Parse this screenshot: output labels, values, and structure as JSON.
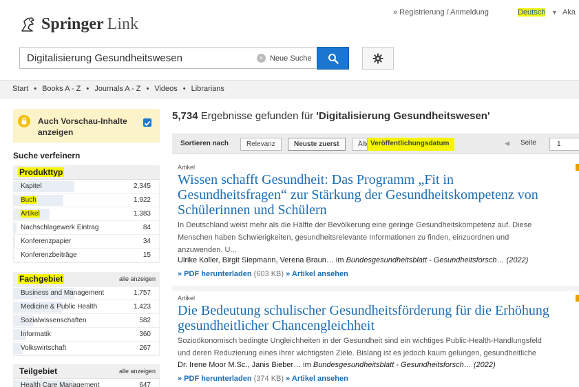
{
  "header": {
    "brand": "Springer",
    "brand_suffix": "Link",
    "register_link": "» Registrierung / Anmeldung",
    "language": "Deutsch",
    "language_caret": "▼",
    "extra": "Aka"
  },
  "search": {
    "value": "Digitalisierung Gesundheitswesen",
    "clear_icon": "×",
    "clear_label": "Neue Suche"
  },
  "nav": {
    "items": [
      "Start",
      "Books A - Z",
      "Journals A - Z",
      "Videos",
      "Librarians"
    ],
    "separator": "•"
  },
  "sidebar": {
    "preview_label": "Auch Vorschau-Inhalte anzeigen",
    "refine_title": "Suche verfeinern",
    "facets": [
      {
        "title": "Produkttyp",
        "all_label": "",
        "items": [
          {
            "label": "Kapitel",
            "count": "2,345",
            "share": 1.0
          },
          {
            "label": "Buch",
            "count": "1,922",
            "share": 0.82
          },
          {
            "label": "Artikel",
            "count": "1,383",
            "share": 0.59
          },
          {
            "label": "Nachschlagewerk Eintrag",
            "count": "84",
            "share": 0.04
          },
          {
            "label": "Konferenzpapier",
            "count": "34",
            "share": 0.02
          },
          {
            "label": "Konferenzbeiträge",
            "count": "15",
            "share": 0.01
          }
        ]
      },
      {
        "title": "Fachgebiet",
        "all_label": "alle anzeigen",
        "items": [
          {
            "label": "Business and Management",
            "count": "1,757",
            "share": 1.0
          },
          {
            "label": "Medicine & Public Health",
            "count": "1,423",
            "share": 0.81
          },
          {
            "label": "Sozialwissenschaften",
            "count": "582",
            "share": 0.33
          },
          {
            "label": "Informatik",
            "count": "360",
            "share": 0.2
          },
          {
            "label": "Volkswirtschaft",
            "count": "267",
            "share": 0.15
          }
        ]
      },
      {
        "title": "Teilgebiet",
        "all_label": "alle anzeigen",
        "items": [
          {
            "label": "Health Care Management",
            "count": "647",
            "share": 1.0
          }
        ]
      }
    ]
  },
  "results": {
    "count": "5,734",
    "count_text": " Ergebnisse gefunden für ",
    "query": "'Digitalisierung Gesundheitswesen'",
    "sort": {
      "label": "Sortieren nach",
      "relevance": "Relevanz",
      "newest": "Neuste zuerst",
      "oldest": "Älteste zuerst",
      "date": "Veröffentlichungsdatum"
    },
    "pagination": {
      "prev": "◀",
      "page_label": "Seite",
      "page_value": "1"
    },
    "items": [
      {
        "type": "Artikel",
        "title_lines": [
          "Wissen schafft Gesundheit: Das Programm „Fit in",
          "Gesundheitsfragen“ zur Stärkung der Gesundheitskompetenz von",
          "Schülerinnen und Schülern"
        ],
        "snippet_lines": [
          "In Deutschland weist mehr als die Hälfte der Bevölkerung eine geringe Gesundheitskompetenz auf. Diese",
          "Menschen haben Schwierigkeiten, gesundheitsrelevante Informationen zu finden, einzuordnen und",
          "anzuwenden. U..."
        ],
        "authors": "Ulrike Koller, Birgit Siepmann, Verena Braun…",
        "in": " im ",
        "journal": "Bundesgesundheitsblatt - Gesundheitsforsch… (2022)",
        "pdf_link": "» PDF herunterladen",
        "pdf_size": " (603 KB) ",
        "view_link": "» Artikel ansehen"
      },
      {
        "type": "Artikel",
        "title_lines": [
          "Die Bedeutung schulischer Gesundheitsförderung für die Erhöhung",
          "gesundheitlicher Chancengleichheit"
        ],
        "snippet_lines": [
          "Sozioökonomisch bedingte Ungleichheiten in der Gesundheit sind ein wichtiges Public-Health-Handlungsfeld",
          "und deren Reduzierung eines ihrer wichtigsten Ziele. Bislang ist es jedoch kaum gelungen, gesundheitliche"
        ],
        "authors": "Dr. Irene Moor M.Sc., Janis Bieber…",
        "in": " im ",
        "journal": "Bundesgesundheitsblatt - Gesundheitsforsch… (2022)",
        "pdf_link": "» PDF herunterladen",
        "pdf_size": " (374 KB) ",
        "view_link": "» Artikel ansehen"
      }
    ]
  },
  "colors": {
    "link": "#1b6db5",
    "highlight": "#f5f500",
    "search_button": "#1a76cf",
    "preview_box": "#fdf3c9"
  },
  "icons": [
    "springer-horse-icon",
    "clear-icon",
    "search-icon",
    "gear-icon",
    "lock-icon",
    "checkbox-icon"
  ]
}
